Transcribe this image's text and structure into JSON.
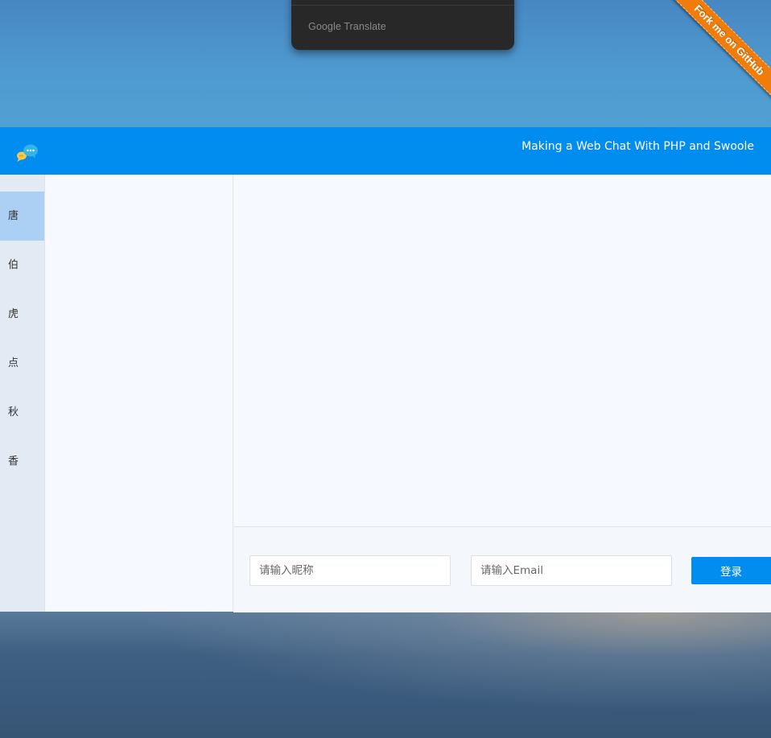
{
  "google_translate": {
    "label": "Google Translate"
  },
  "ribbon": {
    "label": "Fork me on GitHub"
  },
  "header": {
    "title": "Making a Web Chat With PHP and Swoole"
  },
  "letter_rail": {
    "items": [
      {
        "label": "唐",
        "active": true
      },
      {
        "label": "伯",
        "active": false
      },
      {
        "label": "虎",
        "active": false
      },
      {
        "label": "点",
        "active": false
      },
      {
        "label": "秋",
        "active": false
      },
      {
        "label": "香",
        "active": false
      }
    ]
  },
  "login": {
    "nickname_placeholder": "请输入昵称",
    "nickname_value": "",
    "email_placeholder": "请输入Email",
    "email_value": "",
    "submit_label": "登录"
  },
  "colors": {
    "header_bg": "#018cf0",
    "ribbon_bg": "#f07c0a",
    "active_letter_bg": "#acd0f3",
    "rail_bg": "#e4eaf3",
    "chat_bg": "#f6f9ff"
  },
  "icons": {
    "logo": "chat-bubbles-icon"
  }
}
